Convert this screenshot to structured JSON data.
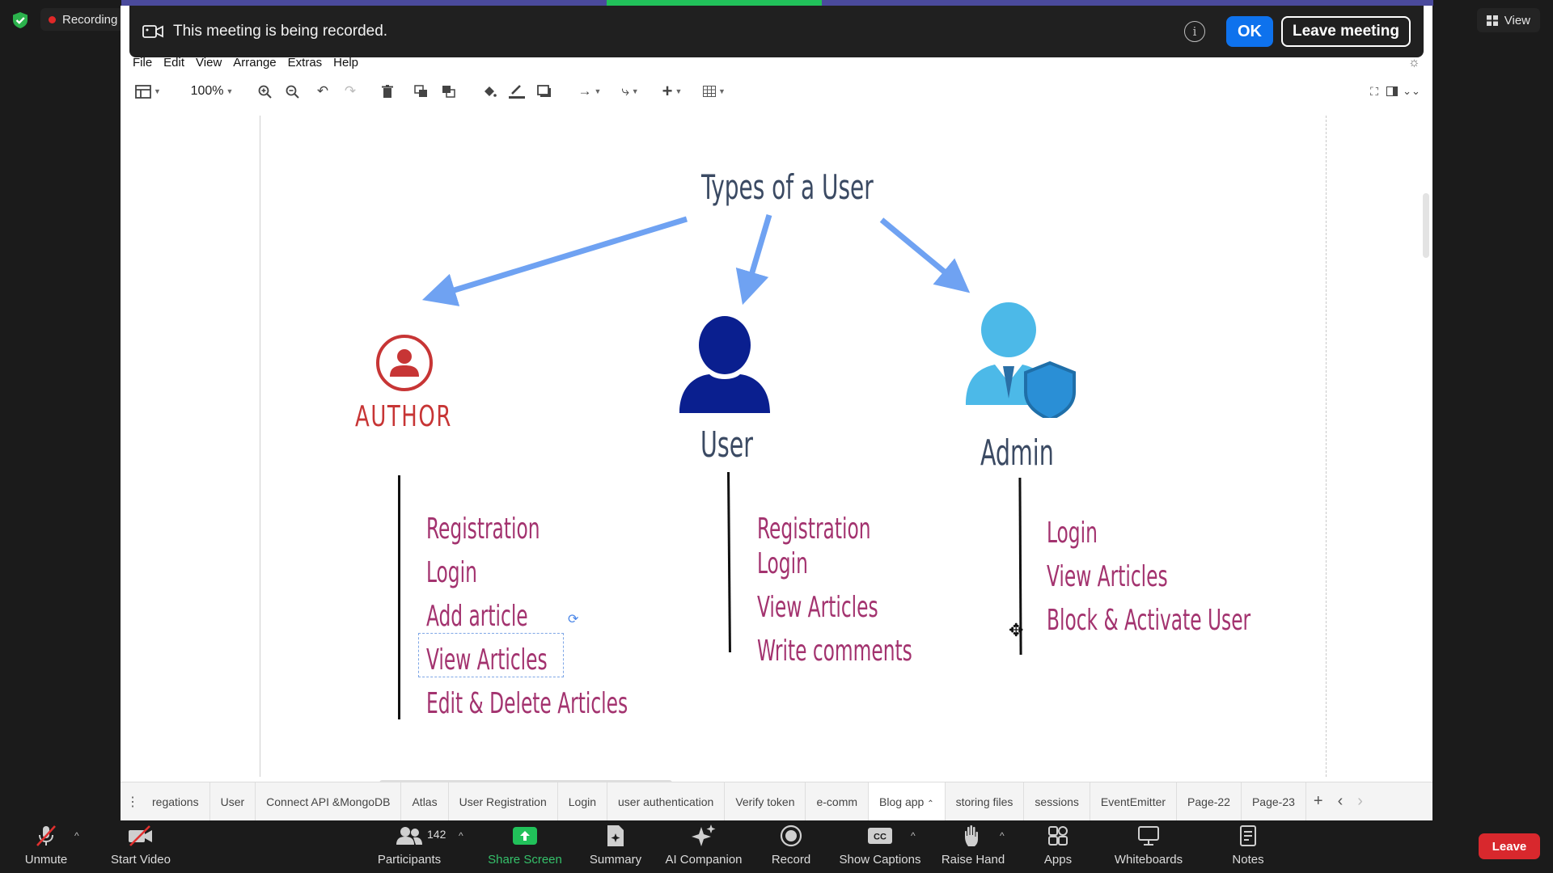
{
  "zoom_top": {
    "recording_label": "Recording",
    "view_label": "View"
  },
  "banner": {
    "message": "This meeting is being recorded.",
    "info_glyph": "i",
    "ok_label": "OK",
    "leave_label": "Leave meeting"
  },
  "drawio": {
    "menu": [
      "File",
      "Edit",
      "View",
      "Arrange",
      "Extras",
      "Help"
    ],
    "zoom_level": "100%",
    "diagram": {
      "title": "Types of a User",
      "roles": [
        {
          "name": "AUTHOR",
          "icon": "author-icon",
          "color": "#c73535",
          "permissions": [
            "Registration",
            "Login",
            "Add article",
            "View Articles",
            "Edit & Delete Articles"
          ]
        },
        {
          "name": "User",
          "icon": "user-silhouette-icon",
          "color": "#0a1f8f",
          "permissions": [
            "Registration",
            "Login",
            "View Articles",
            "Write comments"
          ]
        },
        {
          "name": "Admin",
          "icon": "admin-shield-icon",
          "color": "#4cb9e8",
          "permissions": [
            "Login",
            "View Articles",
            "Block & Activate User"
          ]
        }
      ],
      "arrow_color": "#6fa2f2",
      "text_color": "#a3336f"
    },
    "page_tabs": [
      "regations",
      "User",
      "Connect API &MongoDB",
      "Atlas",
      "User Registration",
      "Login",
      "user authentication",
      "Verify token",
      "e-comm",
      "Blog app",
      "storing files",
      "sessions",
      "EventEmitter",
      "Page-22",
      "Page-23"
    ],
    "active_tab": "Blog app"
  },
  "zoom_toolbar": {
    "unmute": "Unmute",
    "start_video": "Start Video",
    "participants": "Participants",
    "participant_count": "142",
    "share_screen": "Share Screen",
    "summary": "Summary",
    "ai_companion": "AI Companion",
    "record": "Record",
    "show_captions": "Show Captions",
    "raise_hand": "Raise Hand",
    "apps": "Apps",
    "whiteboards": "Whiteboards",
    "notes": "Notes",
    "leave": "Leave"
  }
}
